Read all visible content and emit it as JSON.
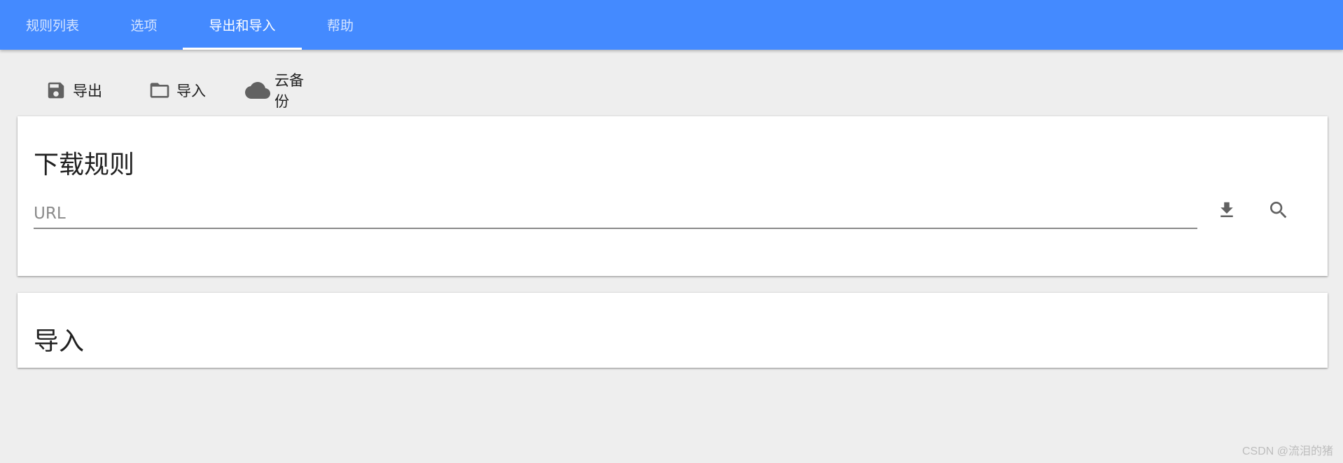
{
  "tabs": [
    {
      "label": "规则列表",
      "active": false
    },
    {
      "label": "选项",
      "active": false
    },
    {
      "label": "导出和导入",
      "active": true
    },
    {
      "label": "帮助",
      "active": false
    }
  ],
  "toolbar": {
    "export_label": "导出",
    "export_icon": "save-icon",
    "import_label": "导入",
    "import_icon": "folder-icon",
    "cloud_label": "云备份",
    "cloud_icon": "cloud-icon"
  },
  "download_rules": {
    "title": "下载规则",
    "url_placeholder": "URL",
    "url_value": "",
    "download_icon": "download-icon",
    "search_icon": "search-icon"
  },
  "import_section": {
    "title": "导入"
  },
  "watermark": "CSDN @流泪的猪",
  "colors": {
    "topbar": "#448aff",
    "background": "#eeeeee",
    "card": "#ffffff",
    "icon": "#616161"
  }
}
